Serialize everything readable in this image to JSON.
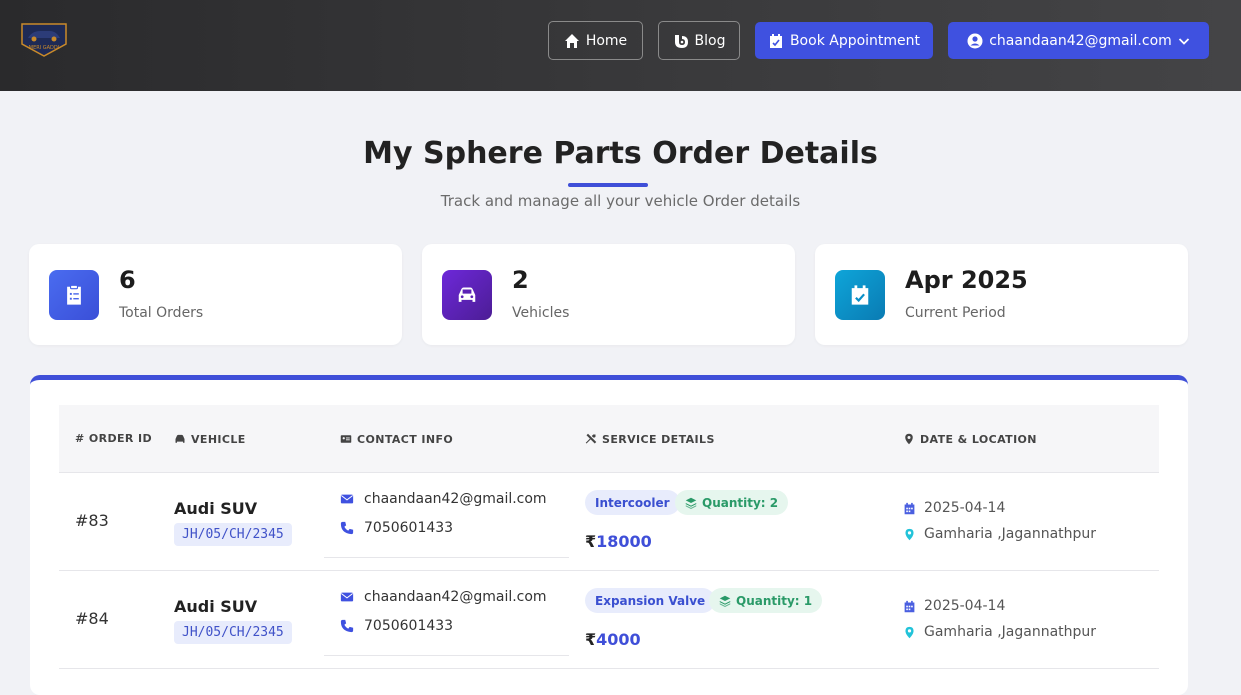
{
  "header": {
    "logo_text": "MERI GADDI",
    "nav": {
      "home": "Home",
      "blog": "Blog",
      "book": "Book Appointment",
      "user": "chaandaan42@gmail.com"
    }
  },
  "page": {
    "title": "My Sphere Parts Order Details",
    "subtitle": "Track and manage all your vehicle Order details"
  },
  "stats": [
    {
      "value": "6",
      "label": "Total Orders",
      "icon": "clipboard-icon",
      "color": "#4a6cf0"
    },
    {
      "value": "2",
      "label": "Vehicles",
      "icon": "car-icon",
      "color": "#5b21b6"
    },
    {
      "value": "Apr 2025",
      "label": "Current Period",
      "icon": "calendar-check-icon",
      "color": "#0a8fc7"
    }
  ],
  "table": {
    "headers": {
      "order_id": "ORDER ID",
      "vehicle": "VEHICLE",
      "contact": "CONTACT INFO",
      "service": "SERVICE DETAILS",
      "date_location": "DATE & LOCATION"
    },
    "rows": [
      {
        "order_id": "#83",
        "vehicle_name": "Audi SUV",
        "plate": "JH/05/CH/2345",
        "email": "chaandaan42@gmail.com",
        "phone": "7050601433",
        "part": "Intercooler",
        "quantity": "Quantity: 2",
        "currency": "₹",
        "price": "18000",
        "date": "2025-04-14",
        "location": "Gamharia ,Jagannathpur"
      },
      {
        "order_id": "#84",
        "vehicle_name": "Audi SUV",
        "plate": "JH/05/CH/2345",
        "email": "chaandaan42@gmail.com",
        "phone": "7050601433",
        "part": "Expansion Valve",
        "quantity": "Quantity: 1",
        "currency": "₹",
        "price": "4000",
        "date": "2025-04-14",
        "location": "Gamharia ,Jagannathpur"
      }
    ]
  },
  "colors": {
    "accent": "#3f51e0",
    "header_bg": "#333335",
    "page_bg": "#f1f2f6"
  }
}
